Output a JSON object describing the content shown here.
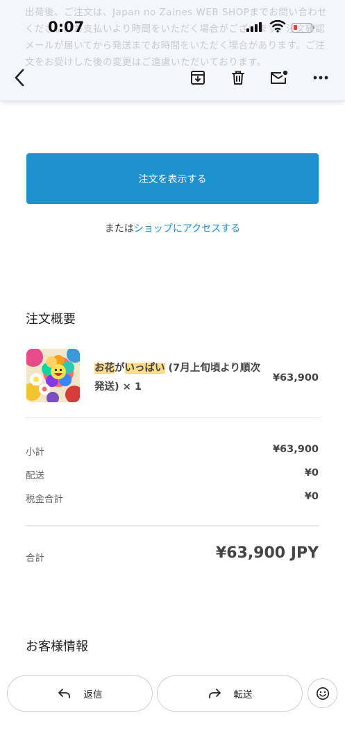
{
  "status_bar": {
    "time": "0:07"
  },
  "background_text": "出荷後、ご注文は、Japan no Zaines WEB SHOPまでお問い合わせください。お支払いより時間をいただく場合がございます。注文確認メールが届いてから発送までお時間をいただく場合があります。ご注文をお受けした後の変更はご遠慮いただいております。",
  "toolbar": {
    "back_icon": "chevron-left-icon",
    "archive_icon": "archive-icon",
    "delete_icon": "trash-icon",
    "mark_unread_icon": "mail-unread-icon",
    "more_icon": "more-horizontal-icon"
  },
  "email": {
    "view_order_button": "注文を表示する",
    "alt_prefix": "または",
    "alt_link": "ショップにアクセスする",
    "order_summary_title": "注文概要",
    "product": {
      "name_highlight_1": "お花",
      "name_mid": "が",
      "name_highlight_2": "いっぱい",
      "name_rest": " (7月上旬頃より順次発送) × 1",
      "price": "¥63,900"
    },
    "subtotal_label": "小計",
    "subtotal_value": "¥63,900",
    "shipping_label": "配送",
    "shipping_value": "¥0",
    "tax_label": "税金合計",
    "tax_value": "¥0",
    "total_label": "合計",
    "total_value": "¥63,900 JPY",
    "customer_info_title": "お客様情報"
  },
  "bottom_bar": {
    "reply_label": "返信",
    "forward_label": "転送",
    "reply_icon": "reply-icon",
    "forward_icon": "forward-icon",
    "emoji_icon": "emoji-smile-icon"
  },
  "colors": {
    "accent": "#1e90cf",
    "highlight": "#fbdc8b",
    "battery_low": "#ff3b30"
  }
}
